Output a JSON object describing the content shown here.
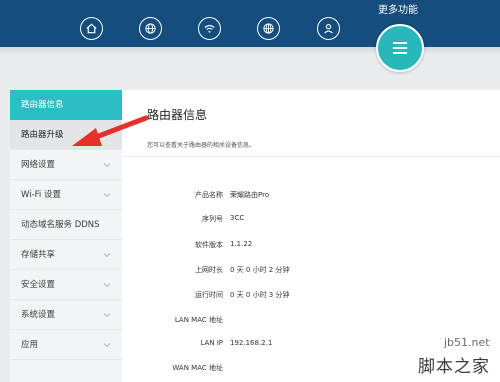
{
  "header": {
    "more_label": "更多功能",
    "icons": [
      "home-icon",
      "globe-icon",
      "wifi-icon",
      "network-globe-icon",
      "user-icon"
    ],
    "background_color": "#144d7e",
    "accent_color": "#2bbfc4"
  },
  "sidebar": {
    "items": [
      {
        "label": "路由器信息",
        "state": "active"
      },
      {
        "label": "路由器升级",
        "state": "selected"
      },
      {
        "label": "网络设置",
        "expandable": true
      },
      {
        "label": "Wi-Fi 设置",
        "expandable": true
      },
      {
        "label": "动态域名服务 DDNS",
        "expandable": false
      },
      {
        "label": "存储共享",
        "expandable": true
      },
      {
        "label": "安全设置",
        "expandable": true
      },
      {
        "label": "系统设置",
        "expandable": true
      },
      {
        "label": "应用",
        "expandable": true
      }
    ]
  },
  "main": {
    "title": "路由器信息",
    "description": "您可以查看关于路由器的相关设备信息。",
    "info": [
      {
        "label": "产品名称",
        "value": "荣耀路由Pro"
      },
      {
        "label": "序列号",
        "value": "3CC"
      },
      {
        "label": "软件版本",
        "value": "1.1.22"
      },
      {
        "label": "上网时长",
        "value": "0 天 0 小时 2 分钟"
      },
      {
        "label": "运行时间",
        "value": "0 天 0 小时 3 分钟"
      },
      {
        "label": "LAN MAC 地址",
        "value": ""
      },
      {
        "label": "LAN IP",
        "value": "192.168.2.1"
      },
      {
        "label": "WAN MAC 地址",
        "value": ""
      }
    ]
  },
  "watermark": {
    "site": "jb51.net",
    "name": "脚本之家"
  }
}
